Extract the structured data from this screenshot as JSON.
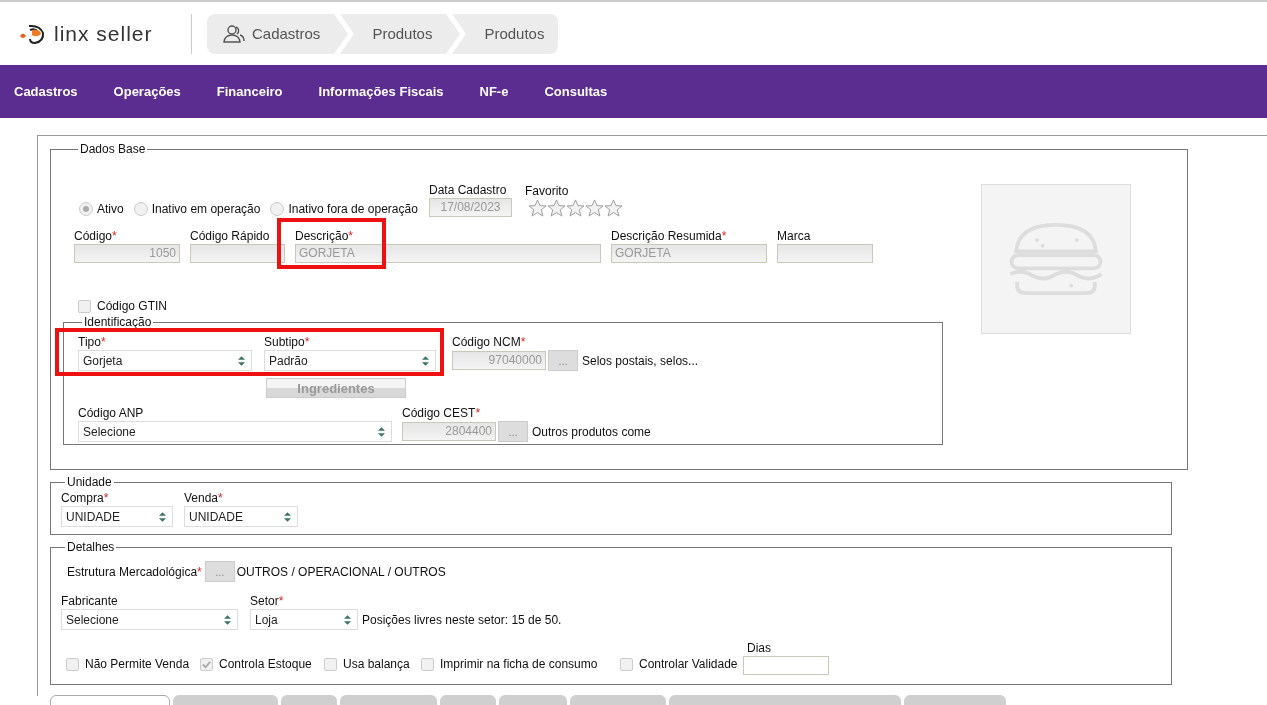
{
  "header": {
    "logo": "linx **seller**",
    "breadcrumbs": [
      "Cadastros",
      "Produtos",
      "Produtos"
    ]
  },
  "menu": [
    "Cadastros",
    "Operações",
    "Financeiro",
    "Informações Fiscais",
    "NF-e",
    "Consultas"
  ],
  "dados_base": {
    "legend": "Dados Base",
    "status": [
      {
        "label": "Ativo",
        "selected": true
      },
      {
        "label": "Inativo em operação",
        "selected": false
      },
      {
        "label": "Inativo fora de operação",
        "selected": false
      }
    ],
    "data_cadastro": {
      "label": "Data Cadastro",
      "value": "17/08/2023"
    },
    "favorito": {
      "label": "Favorito",
      "stars": 0
    },
    "fields": [
      {
        "label": "Código",
        "mark": "*",
        "value": "1050",
        "kind": "number"
      },
      {
        "label": "Código Rápido",
        "kind": "text"
      },
      {
        "label": "Descrição",
        "mark": "*",
        "value": "GORJETA",
        "kind": "text"
      },
      {
        "label": "Descrição Resumida",
        "mark": "*",
        "value": "GORJETA",
        "kind": "text"
      },
      {
        "label": "Marca",
        "kind": "text"
      }
    ],
    "gtin": {
      "label": "Código GTIN",
      "checked": false
    },
    "identificacao": {
      "legend": "Identificação",
      "tipo": {
        "label": "Tipo",
        "mark": "*",
        "value": "Gorjeta"
      },
      "subtipo": {
        "label": "Subtipo",
        "mark": "*",
        "value": "Padrão"
      },
      "ingredientes": "Ingredientes",
      "ncm": {
        "label": "Código NCM",
        "mark": "*",
        "value": "97040000",
        "button": "...",
        "description": "Selos postais, selos..."
      },
      "anp": {
        "label": "Código ANP",
        "value": "Selecione"
      },
      "cest": {
        "label": "Código CEST",
        "mark": "*",
        "value": "2804400",
        "button": "...",
        "description": "Outros produtos come"
      }
    }
  },
  "unidade": {
    "legend": "Unidade",
    "selects": [
      {
        "label": "Compra",
        "mark": "*",
        "value": "UNIDADE"
      },
      {
        "label": "Venda",
        "mark": "*",
        "value": "UNIDADE"
      }
    ]
  },
  "detalhes": {
    "legend": "Detalhes",
    "estrutura": {
      "label": "Estrutura Mercadológica",
      "mark": "*",
      "button": "...",
      "value": "OUTROS / OPERACIONAL / OUTROS"
    },
    "fabricante": {
      "label": "Fabricante",
      "value": "Selecione"
    },
    "setor": {
      "label": "Setor",
      "mark": "*",
      "value": "Loja",
      "note": "Posições livres neste setor: 15 de 50."
    },
    "options": [
      {
        "label": "Não Permite Venda",
        "checked": false
      },
      {
        "label": "Controla Estoque",
        "checked": true
      },
      {
        "label": "Usa balança",
        "checked": false
      },
      {
        "label": "Imprimir na ficha de consumo",
        "checked": false
      },
      {
        "label": "Controlar Validade",
        "checked": false
      }
    ],
    "dias": {
      "label": "Dias"
    }
  },
  "bottom_tabs": [
    {
      "selected": true
    },
    {
      "selected": false
    },
    {
      "selected": false
    },
    {
      "selected": false
    },
    {
      "selected": false
    },
    {
      "selected": false
    },
    {
      "selected": false
    },
    {
      "selected": false
    },
    {
      "selected": false
    }
  ]
}
